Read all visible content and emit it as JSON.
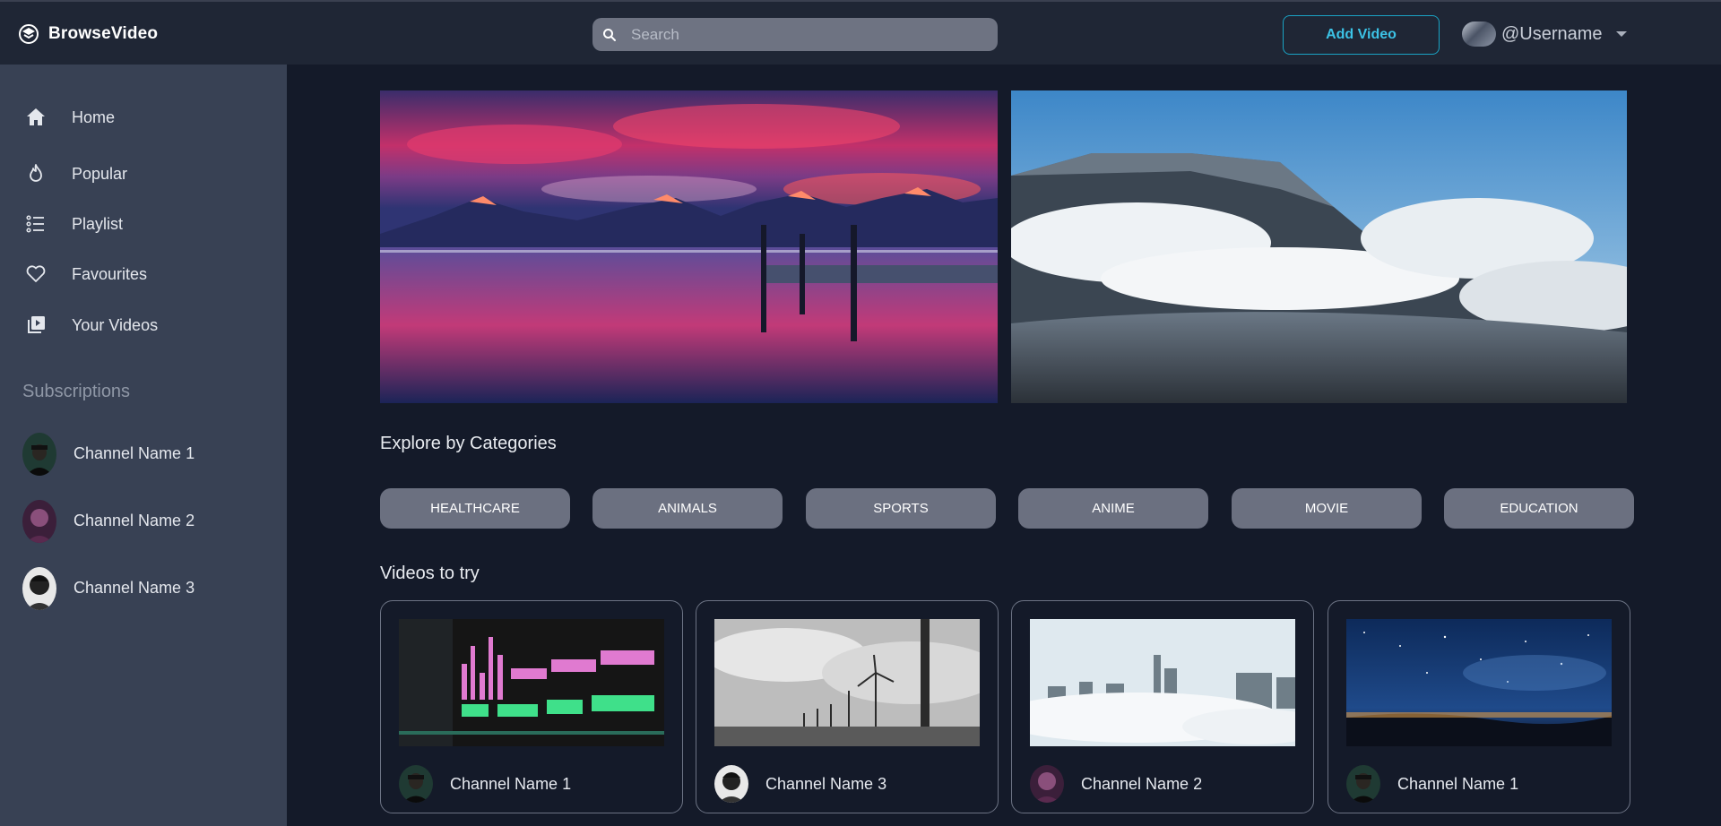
{
  "app": {
    "name": "BrowseVideo"
  },
  "search": {
    "placeholder": "Search"
  },
  "header": {
    "add_video_label": "Add Video",
    "username": "@Username"
  },
  "sidebar": {
    "nav": [
      {
        "label": "Home",
        "icon": "home-icon"
      },
      {
        "label": "Popular",
        "icon": "flame-icon"
      },
      {
        "label": "Playlist",
        "icon": "list-icon"
      },
      {
        "label": "Favourites",
        "icon": "heart-icon"
      },
      {
        "label": "Your Videos",
        "icon": "video-library-icon"
      }
    ],
    "subscriptions_title": "Subscriptions",
    "subscriptions": [
      {
        "label": "Channel Name 1"
      },
      {
        "label": "Channel Name 2"
      },
      {
        "label": "Channel Name 3"
      }
    ]
  },
  "main": {
    "categories_title": "Explore by Categories",
    "categories": [
      "HEALTHCARE",
      "ANIMALS",
      "SPORTS",
      "ANIME",
      "MOVIE",
      "EDUCATION"
    ],
    "videos_title": "Videos to try",
    "videos": [
      {
        "channel": "Channel Name 1"
      },
      {
        "channel": "Channel Name 3"
      },
      {
        "channel": "Channel Name 2"
      },
      {
        "channel": "Channel Name 1"
      }
    ]
  },
  "colors": {
    "page_bg": "#141a29",
    "header_bg": "#1f2635",
    "sidebar_bg": "#384154",
    "accent": "#1aa3c4",
    "pill_bg": "#6b7080"
  }
}
